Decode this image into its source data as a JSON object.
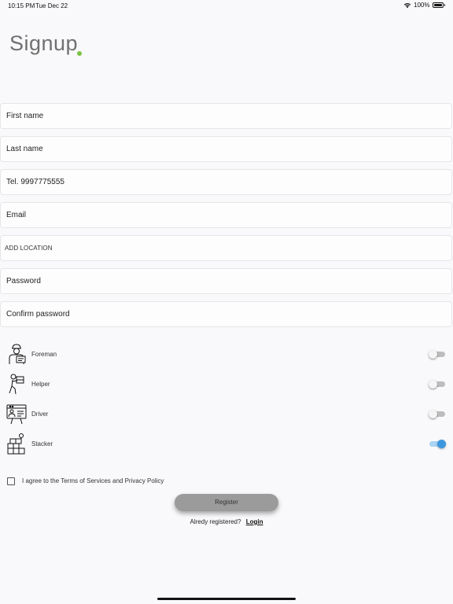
{
  "status_bar": {
    "time": "10:15 PM",
    "date": "Tue Dec 22",
    "battery": "100%"
  },
  "page": {
    "title": "Signup"
  },
  "form": {
    "first_name_placeholder": "First name",
    "last_name_placeholder": "Last name",
    "phone_placeholder": "Tel. 9997775555",
    "email_placeholder": "Email",
    "location_label": "ADD LOCATION",
    "password_placeholder": "Password",
    "confirm_password_placeholder": "Confirm password"
  },
  "roles": [
    {
      "label": "Foreman",
      "icon": "foreman-icon",
      "enabled": false
    },
    {
      "label": "Helper",
      "icon": "helper-icon",
      "enabled": false
    },
    {
      "label": "Driver",
      "icon": "driver-icon",
      "enabled": false
    },
    {
      "label": "Stacker",
      "icon": "stacker-icon",
      "enabled": true
    }
  ],
  "agreement": {
    "text": "I agree to the Terms of Services and Privacy Policy",
    "checked": false
  },
  "actions": {
    "register_label": "Register",
    "already_registered": "Alredy registered?",
    "login_label": "Login"
  },
  "colors": {
    "accent_dot": "#7cc243",
    "toggle_on": "#3d97e0",
    "register_bg": "#9b9b9b"
  }
}
